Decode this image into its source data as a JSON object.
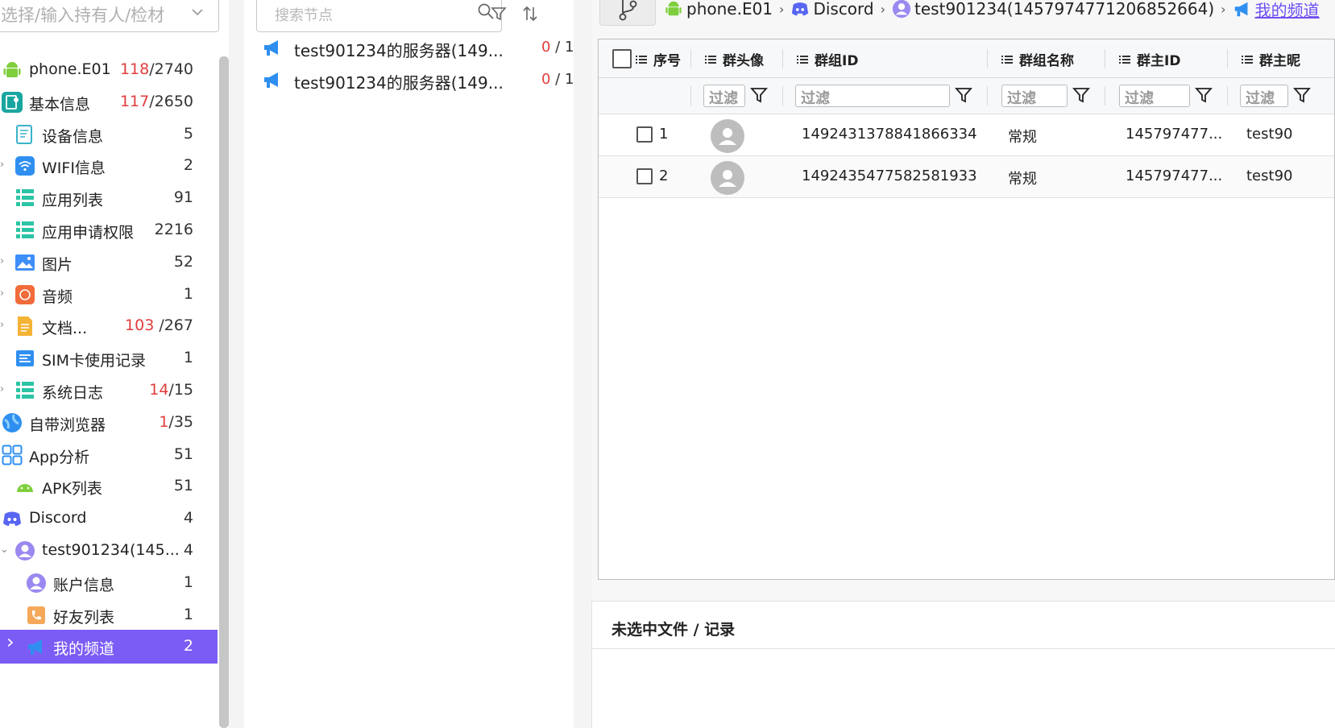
{
  "left": {
    "holder_placeholder": "选择/输入持有人/检材",
    "tree": [
      {
        "label": "phone.E01",
        "count_red": "118",
        "count_rest": "/2740",
        "icon": "android-icon",
        "color": "#7fcf3d",
        "caret": false
      },
      {
        "label": "基本信息",
        "count_red": "117",
        "count_rest": "/2650",
        "icon": "basic-info-icon",
        "color": "#1aa6a0",
        "caret": false
      },
      {
        "label": "设备信息",
        "count_red": "",
        "count_rest": "5",
        "icon": "device-info-icon",
        "color": "#3ab3c9",
        "caret": false
      },
      {
        "label": "WIFI信息",
        "count_red": "",
        "count_rest": "2",
        "icon": "wifi-icon",
        "color": "#2f8ff0",
        "caret": true
      },
      {
        "label": "应用列表",
        "count_red": "",
        "count_rest": "91",
        "icon": "app-list-icon",
        "color": "#2cc4a5",
        "caret": false
      },
      {
        "label": "应用申请权限",
        "count_red": "",
        "count_rest": "2216",
        "icon": "app-permission-icon",
        "color": "#2cc4a5",
        "caret": false
      },
      {
        "label": "图片",
        "count_red": "",
        "count_rest": "52",
        "icon": "picture-icon",
        "color": "#3e8ef7",
        "caret": true
      },
      {
        "label": "音频",
        "count_red": "",
        "count_rest": "1",
        "icon": "audio-icon",
        "color": "#f26b3a",
        "caret": true
      },
      {
        "label": "文档...",
        "count_red": "103",
        "count_rest": " /267",
        "icon": "document-icon",
        "color": "#f5b335",
        "caret": true
      },
      {
        "label": "SIM卡使用记录",
        "count_red": "",
        "count_rest": "1",
        "icon": "sim-record-icon",
        "color": "#2f8ff0",
        "caret": false
      },
      {
        "label": "系统日志",
        "count_red": "14",
        "count_rest": "/15",
        "icon": "system-log-icon",
        "color": "#2cc4a5",
        "caret": true
      },
      {
        "label": "自带浏览器",
        "count_red": "1",
        "count_rest": "/35",
        "icon": "browser-icon",
        "color": "#2f8ff0",
        "caret": false
      },
      {
        "label": "App分析",
        "count_red": "",
        "count_rest": "51",
        "icon": "app-analysis-icon",
        "color": "#2f8ff0",
        "caret": false
      },
      {
        "label": "APK列表",
        "count_red": "",
        "count_rest": "51",
        "icon": "apk-list-icon",
        "color": "#7fcf3d",
        "caret": false
      },
      {
        "label": "Discord",
        "count_red": "",
        "count_rest": "4",
        "icon": "discord-icon",
        "color": "#5865f2",
        "caret": false
      },
      {
        "label": "test901234(145...",
        "count_red": "",
        "count_rest": "4",
        "icon": "user-avatar-icon",
        "color": "#9b88f0",
        "caret": true
      },
      {
        "label": "账户信息",
        "count_red": "",
        "count_rest": "1",
        "icon": "account-info-icon",
        "color": "#9b88f0",
        "caret": false
      },
      {
        "label": "好友列表",
        "count_red": "",
        "count_rest": "1",
        "icon": "friend-list-icon",
        "color": "#f5a85a",
        "caret": false
      },
      {
        "label": "我的频道",
        "count_red": "",
        "count_rest": "2",
        "icon": "channel-icon",
        "color": "#2f8ff0",
        "caret": true
      }
    ]
  },
  "middle": {
    "search_placeholder": "搜索节点",
    "items": [
      {
        "label": "test901234的服务器(149...",
        "count_red": "0",
        "count_rest": " / 1"
      },
      {
        "label": "test901234的服务器(149...",
        "count_red": "0",
        "count_rest": " / 1"
      }
    ]
  },
  "right": {
    "breadcrumb": [
      {
        "label": "phone.E01",
        "icon": "android-icon"
      },
      {
        "label": "Discord",
        "icon": "discord-icon"
      },
      {
        "label": "test901234(1457974771206852664)",
        "icon": "user-avatar-icon"
      },
      {
        "label": "我的频道",
        "icon": "channel-icon"
      }
    ],
    "columns": [
      "序号",
      "群头像",
      "群组ID",
      "群组名称",
      "群主ID",
      "群主昵"
    ],
    "filter_placeholder": "过滤",
    "rows": [
      {
        "index": "1",
        "group_id": "1492431378841866334",
        "group_name": "常规",
        "owner_id": "145797477...",
        "owner_nick": "test90"
      },
      {
        "index": "2",
        "group_id": "1492435477582581933",
        "group_name": "常规",
        "owner_id": "145797477...",
        "owner_nick": "test90"
      }
    ],
    "detail_title": "未选中文件 / 记录"
  },
  "colors": {
    "accent": "#7b5cf5",
    "count_red": "#e23d3d",
    "link": "#6f4ff2"
  }
}
